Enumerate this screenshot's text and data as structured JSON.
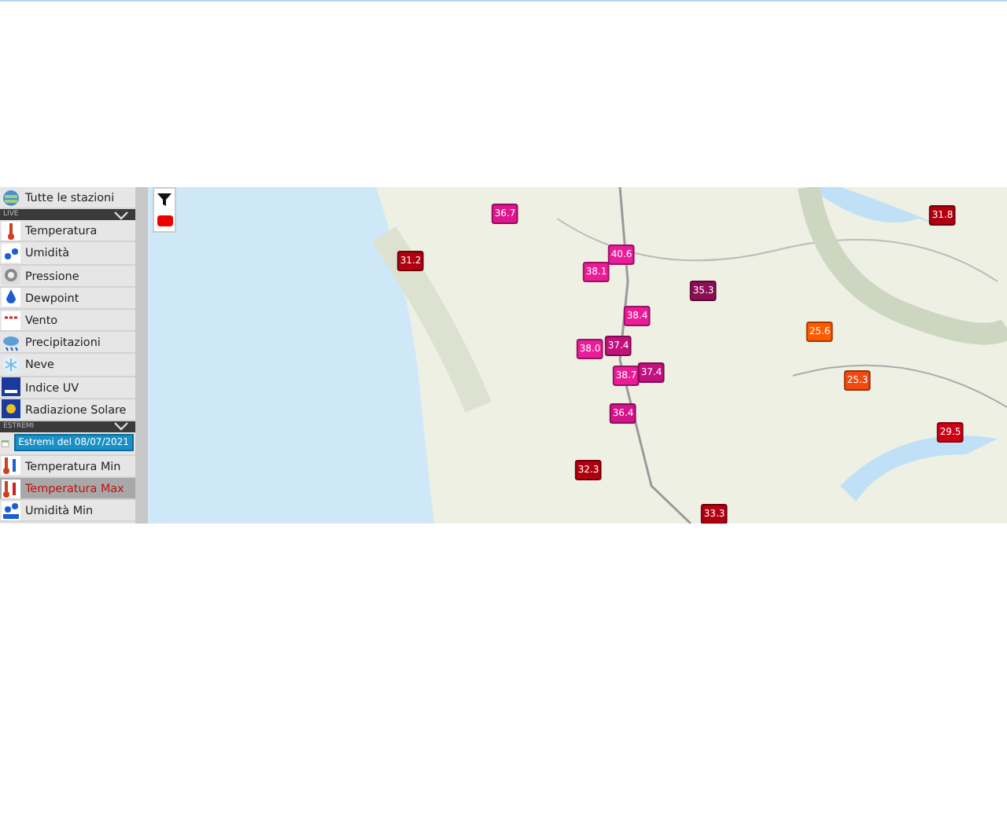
{
  "sidebar": {
    "top_item": {
      "label": "Tutte le stazioni",
      "selected": false
    },
    "sections": [
      {
        "title": "LIVE",
        "expanded": true,
        "items": [
          {
            "label": "Temperatura",
            "selected": false
          },
          {
            "label": "Umidità",
            "selected": false
          },
          {
            "label": "Pressione",
            "selected": false
          },
          {
            "label": "Dewpoint",
            "selected": false
          },
          {
            "label": "Vento",
            "selected": false
          },
          {
            "label": "Precipitazioni",
            "selected": false
          },
          {
            "label": "Neve",
            "selected": false
          },
          {
            "label": "Indice UV",
            "selected": false
          },
          {
            "label": "Radiazione Solare",
            "selected": false
          }
        ]
      },
      {
        "title": "ESTREMI",
        "expanded": true,
        "date_button": "Estremi del 08/07/2021",
        "items": [
          {
            "label": "Temperatura Min",
            "selected": false
          },
          {
            "label": "Temperatura Max",
            "selected": true
          },
          {
            "label": "Umidità Min",
            "selected": false
          }
        ]
      }
    ]
  },
  "map": {
    "markers": [
      {
        "value": "36.7",
        "color": "#e0158f"
      },
      {
        "value": "31.2",
        "color": "#b00010"
      },
      {
        "value": "40.6",
        "color": "#ea1c97"
      },
      {
        "value": "38.1",
        "color": "#ea1c97"
      },
      {
        "value": "35.3",
        "color": "#8a0f55"
      },
      {
        "value": "38.4",
        "color": "#ea1c97"
      },
      {
        "value": "38.0",
        "color": "#ea1c97"
      },
      {
        "value": "37.4",
        "color": "#c4107e"
      },
      {
        "value": "38.7",
        "color": "#ea1c97"
      },
      {
        "value": "37.4",
        "color": "#c4107e"
      },
      {
        "value": "36.4",
        "color": "#d4128a"
      },
      {
        "value": "32.3",
        "color": "#b00010"
      },
      {
        "value": "33.3",
        "color": "#b00010"
      },
      {
        "value": "31.8",
        "color": "#b00010"
      },
      {
        "value": "25.6",
        "color": "#ff5a00"
      },
      {
        "value": "25.3",
        "color": "#f04a10"
      },
      {
        "value": "29.5",
        "color": "#cc0015"
      }
    ]
  }
}
